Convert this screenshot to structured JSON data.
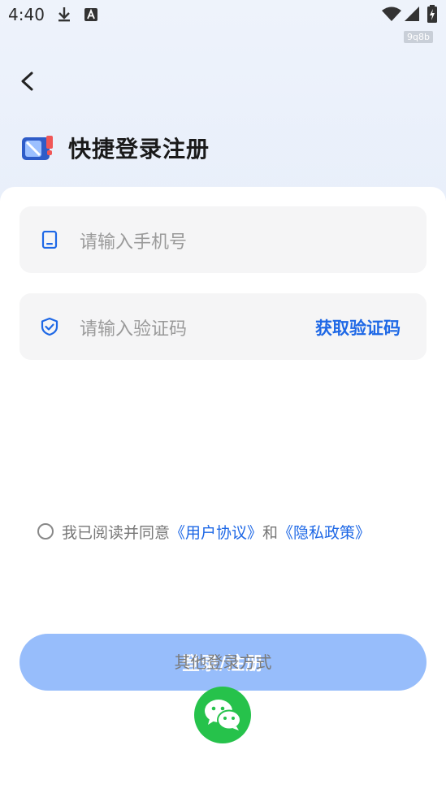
{
  "status_bar": {
    "time": "4:40",
    "icons": [
      "download-icon",
      "a-icon",
      "wifi-icon",
      "signal-icon",
      "battery-charging-icon"
    ],
    "watermark": "9q8b"
  },
  "header": {
    "title": "快捷登录注册",
    "logo": "phone-logo-icon"
  },
  "form": {
    "phone": {
      "placeholder": "请输入手机号",
      "icon": "phone-icon"
    },
    "code": {
      "placeholder": "请输入验证码",
      "icon": "shield-icon",
      "action": "获取验证码"
    },
    "submit": "登录/注册"
  },
  "agreement": {
    "prefix": "我已阅读并同意",
    "user_agreement": "《用户协议》",
    "conjunction": "和",
    "privacy_policy": "《隐私政策》"
  },
  "other_login": {
    "title": "其他登录方式",
    "wechat_icon": "wechat-icon"
  },
  "colors": {
    "accent": "#1e68e6",
    "button_disabled": "#97bdfb",
    "wechat": "#26c24b"
  }
}
